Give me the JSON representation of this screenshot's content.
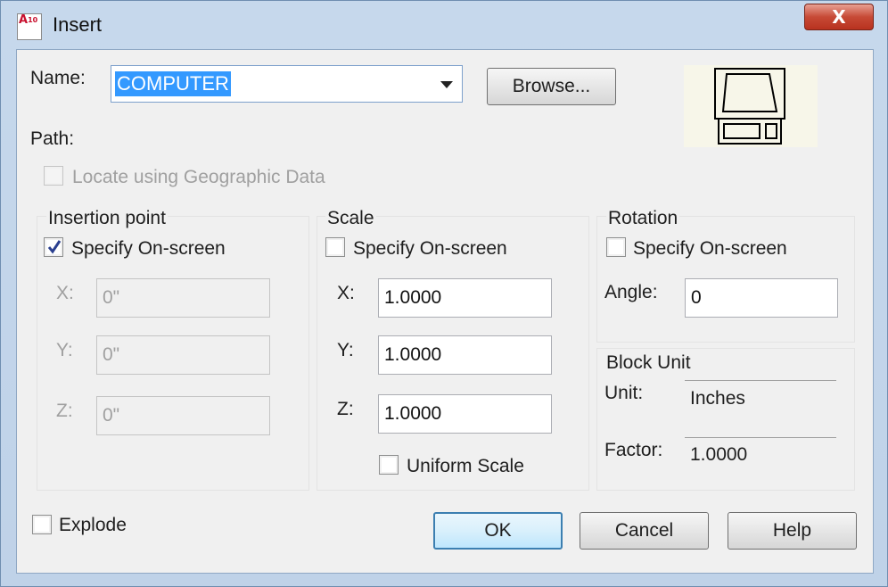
{
  "window": {
    "title": "Insert",
    "icon_text": "A",
    "icon_version": "10",
    "close_glyph": "X"
  },
  "name": {
    "label": "Name:",
    "value": "COMPUTER",
    "browse_button": "Browse..."
  },
  "path": {
    "label": "Path:"
  },
  "geo": {
    "label": "Locate using Geographic Data",
    "checked": false,
    "enabled": false
  },
  "insertion_point": {
    "title": "Insertion point",
    "specify_label": "Specify On-screen",
    "specify_checked": true,
    "x_label": "X:",
    "x_value": "0\"",
    "y_label": "Y:",
    "y_value": "0\"",
    "z_label": "Z:",
    "z_value": "0\""
  },
  "scale": {
    "title": "Scale",
    "specify_label": "Specify On-screen",
    "specify_checked": false,
    "x_label": "X:",
    "x_value": "1.0000",
    "y_label": "Y:",
    "y_value": "1.0000",
    "z_label": "Z:",
    "z_value": "1.0000",
    "uniform_label": "Uniform Scale",
    "uniform_checked": false
  },
  "rotation": {
    "title": "Rotation",
    "specify_label": "Specify On-screen",
    "specify_checked": false,
    "angle_label": "Angle:",
    "angle_value": "0"
  },
  "block_unit": {
    "title": "Block Unit",
    "unit_label": "Unit:",
    "unit_value": "Inches",
    "factor_label": "Factor:",
    "factor_value": "1.0000"
  },
  "explode": {
    "label": "Explode",
    "checked": false
  },
  "buttons": {
    "ok": "OK",
    "cancel": "Cancel",
    "help": "Help"
  }
}
